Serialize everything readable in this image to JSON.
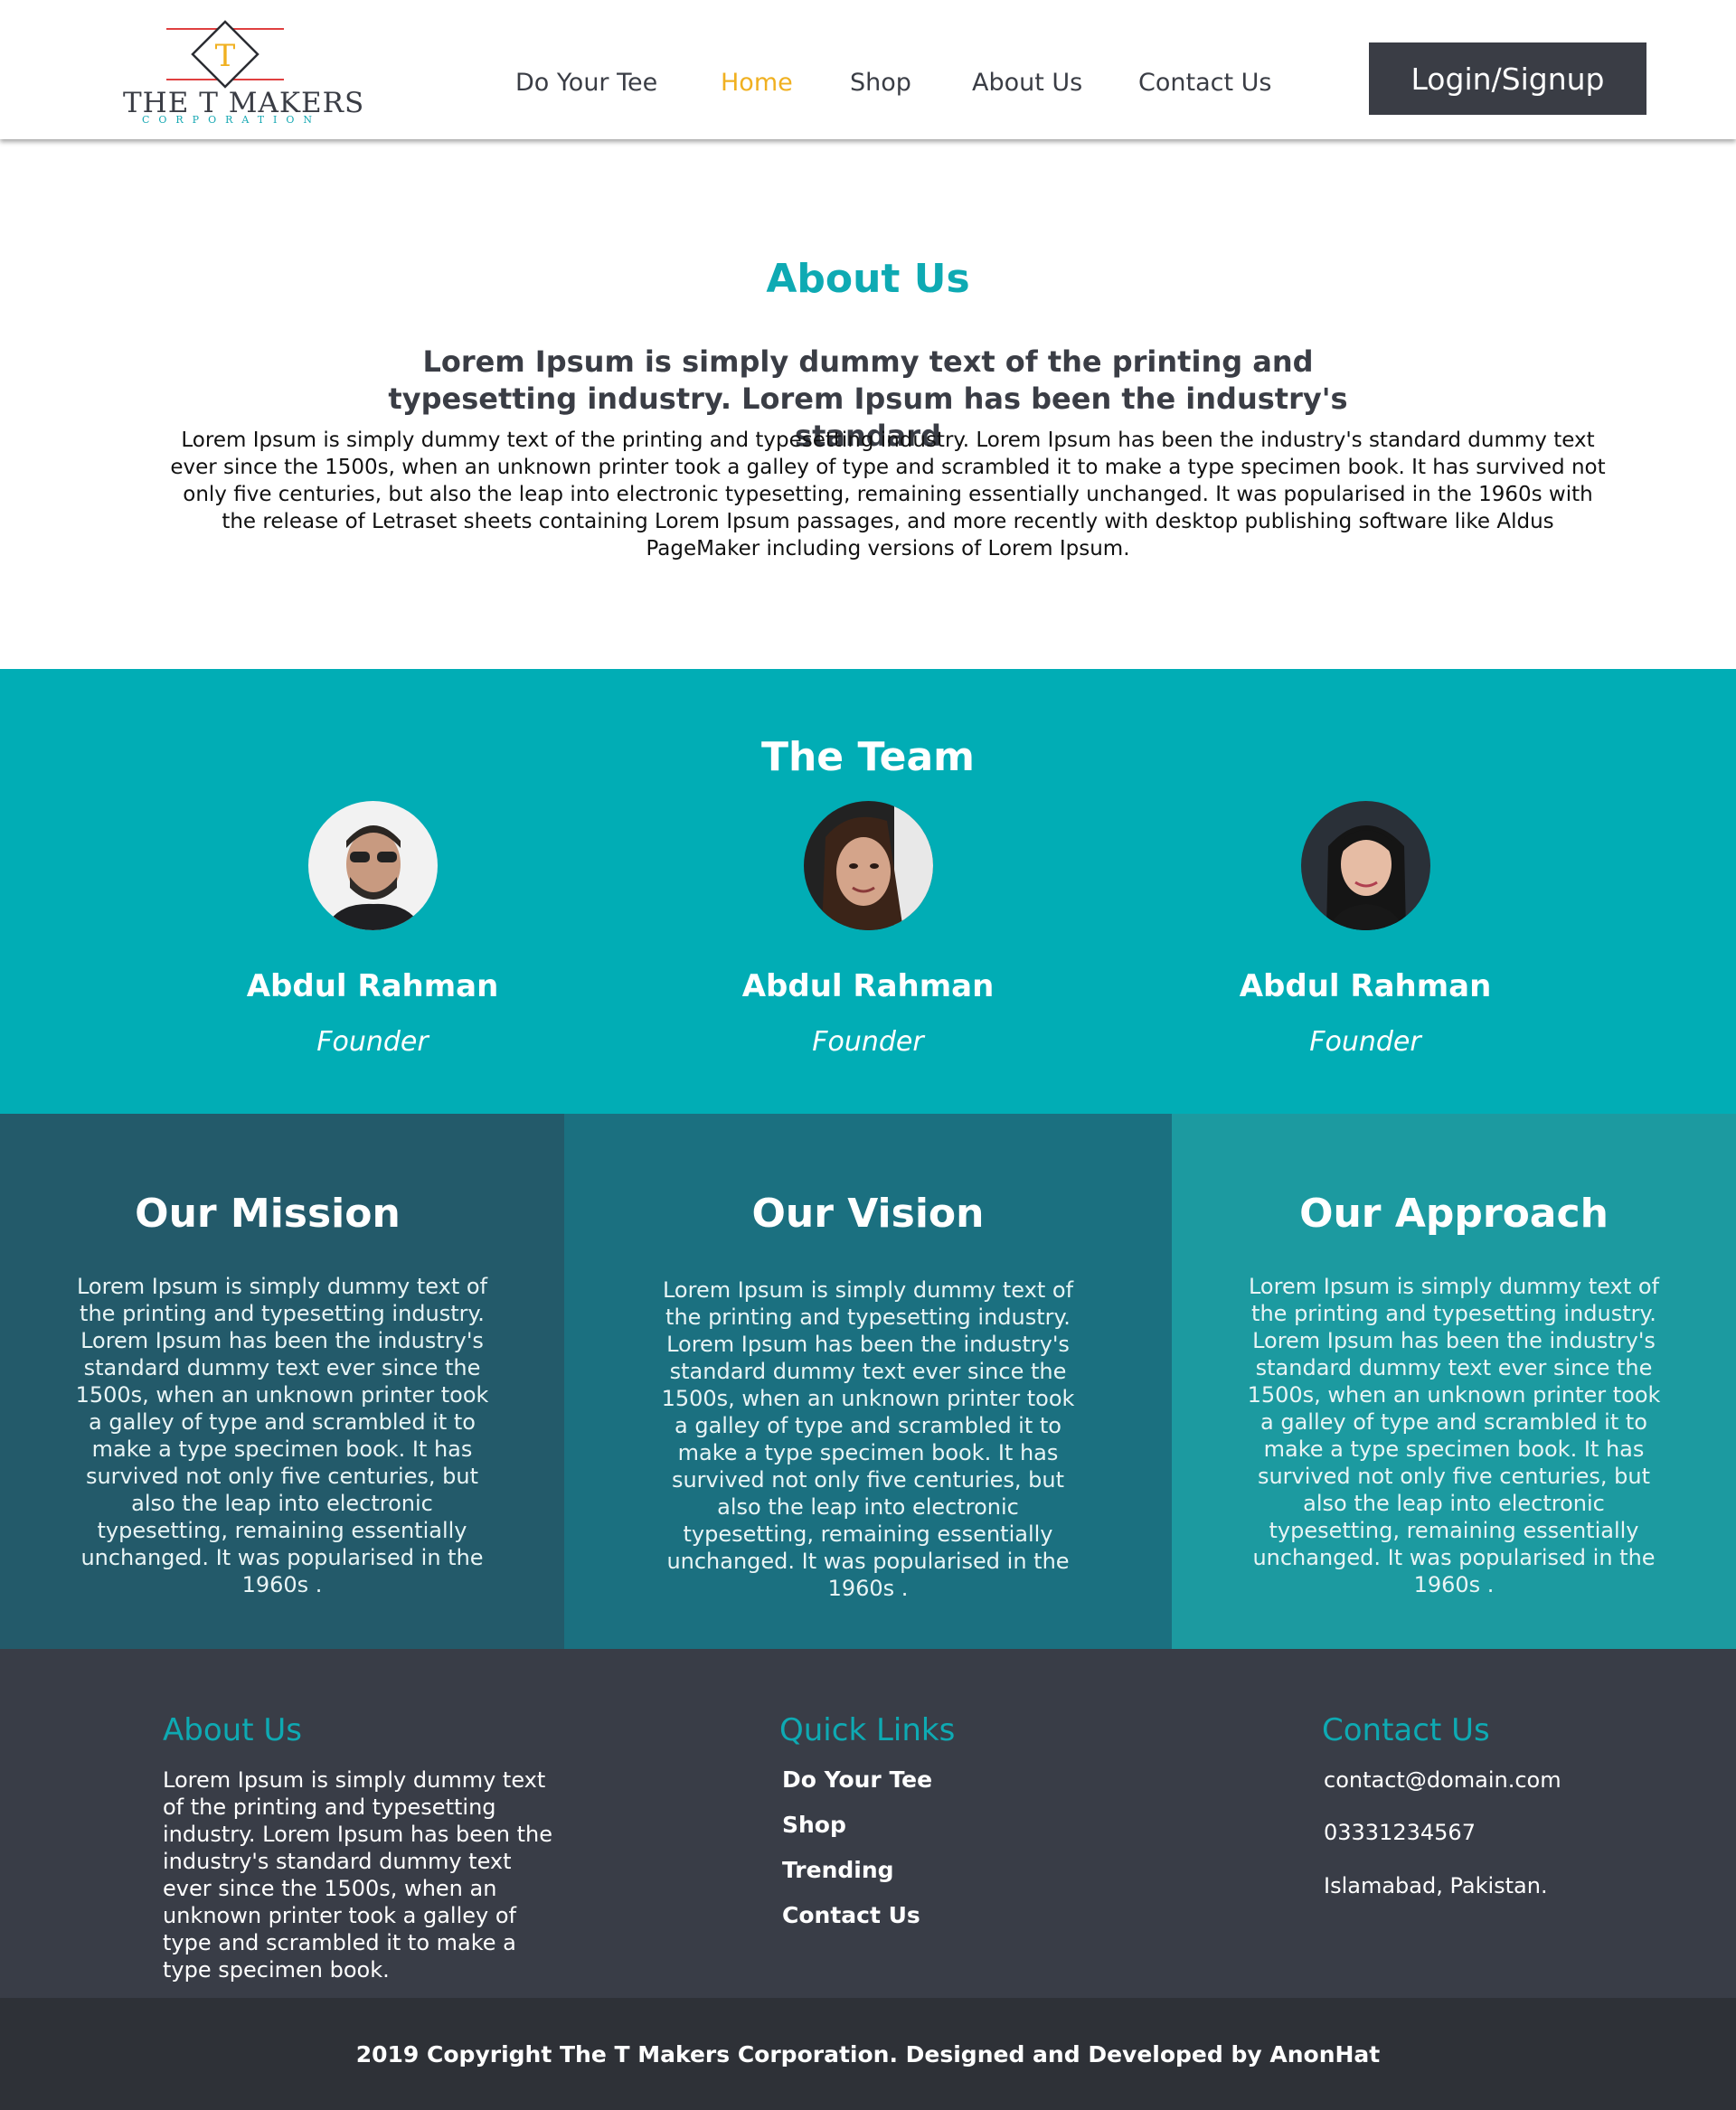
{
  "brand": {
    "logo_letter": "T",
    "title": "THE T MAKERS",
    "subtitle": "CORPORATION"
  },
  "nav": {
    "items": [
      {
        "label": "Do Your Tee",
        "active": false
      },
      {
        "label": "Home",
        "active": true
      },
      {
        "label": "Shop",
        "active": false
      },
      {
        "label": "About Us",
        "active": false
      },
      {
        "label": "Contact Us",
        "active": false
      }
    ],
    "login_label": "Login/Signup"
  },
  "about": {
    "title": "About Us",
    "subtitle": "Lorem Ipsum is simply dummy text of the printing and typesetting industry. Lorem Ipsum has been the industry's standard",
    "body": "Lorem Ipsum is simply dummy text of the printing and typesetting industry. Lorem Ipsum has been the industry's standard dummy text ever since the 1500s, when an unknown printer took a galley of type and scrambled it to make a type specimen book. It has survived not only five centuries, but also the leap into electronic typesetting, remaining essentially unchanged. It was popularised in the 1960s with the release of Letraset sheets containing Lorem Ipsum passages, and more recently with desktop publishing software like Aldus PageMaker including versions of Lorem Ipsum."
  },
  "team": {
    "title": "The Team",
    "members": [
      {
        "name": "Abdul Rahman",
        "role": "Founder"
      },
      {
        "name": "Abdul Rahman",
        "role": "Founder"
      },
      {
        "name": "Abdul Rahman",
        "role": "Founder"
      }
    ]
  },
  "mva": [
    {
      "title": "Our Mission",
      "body": "Lorem Ipsum is simply dummy text of the printing and typesetting industry. Lorem Ipsum has been the industry's standard dummy text ever since the 1500s, when an unknown printer took a galley of type and scrambled it to make a type specimen book. It has survived not only five centuries, but also the leap into electronic typesetting, remaining essentially unchanged. It was popularised in the 1960s ."
    },
    {
      "title": "Our Vision",
      "body": "Lorem Ipsum is simply dummy text of the printing and typesetting industry. Lorem Ipsum has been the industry's standard dummy text ever since the 1500s, when an unknown printer took a galley of type and scrambled it to make a type specimen book. It has survived not only five centuries, but also the leap into electronic typesetting, remaining essentially unchanged. It was popularised in the 1960s ."
    },
    {
      "title": "Our Approach",
      "body": "Lorem Ipsum is simply dummy text of the printing and typesetting industry. Lorem Ipsum has been the industry's standard dummy text ever since the 1500s, when an unknown printer took a galley of type and scrambled it to make a type specimen book. It has survived not only five centuries, but also the leap into electronic typesetting, remaining essentially unchanged. It was popularised in the 1960s ."
    }
  ],
  "footer": {
    "about": {
      "title": "About Us",
      "body": "Lorem Ipsum is simply dummy text of the printing and typesetting industry. Lorem Ipsum has been the industry's standard dummy text ever since the 1500s, when an unknown printer took a galley of type and scrambled it to make a type specimen book."
    },
    "quick_links": {
      "title": "Quick Links",
      "items": [
        "Do Your Tee",
        "Shop",
        "Trending",
        "Contact Us"
      ]
    },
    "contact": {
      "title": "Contact Us",
      "email": "contact@domain.com",
      "phone": "03331234567",
      "address": "Islamabad, Pakistan."
    },
    "copyright": "2019 Copyright The T Makers Corporation. Designed and Developed by AnonHat"
  },
  "colors": {
    "accent": "#01adb5",
    "active_nav": "#f0b020",
    "dark": "#393d47",
    "mission_bg": "#235a6a",
    "vision_bg": "#1b7080",
    "approach_bg": "#1c9aa0"
  }
}
